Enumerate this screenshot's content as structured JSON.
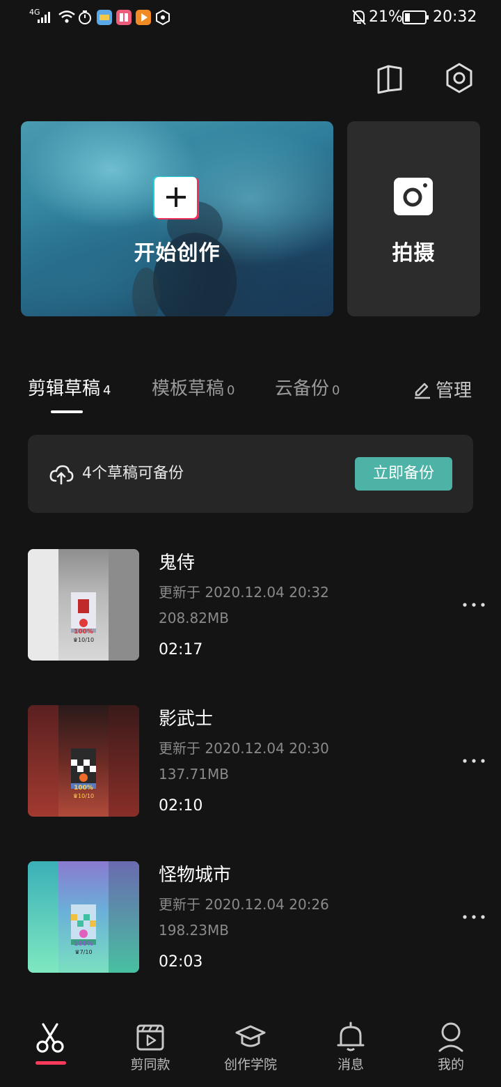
{
  "status_bar": {
    "network": "4G",
    "battery": "21%",
    "time": "20:32"
  },
  "header": {
    "icons": [
      "tutorial-book-icon",
      "settings-hexagon-icon"
    ]
  },
  "hero": {
    "create_label": "开始创作",
    "shoot_label": "拍摄"
  },
  "tabs": [
    {
      "label": "剪辑草稿",
      "count": "4"
    },
    {
      "label": "模板草稿",
      "count": "0"
    },
    {
      "label": "云备份",
      "count": "0"
    }
  ],
  "manage_label": "管理",
  "backup": {
    "text": "4个草稿可备份",
    "button": "立即备份"
  },
  "drafts": [
    {
      "title": "鬼侍",
      "updated": "更新于 2020.12.04 20:32",
      "size": "208.82MB",
      "duration": "02:17",
      "thumb_pct": "100%",
      "thumb_level": "♛10/10"
    },
    {
      "title": "影武士",
      "updated": "更新于 2020.12.04 20:30",
      "size": "137.71MB",
      "duration": "02:10",
      "thumb_pct": "100%",
      "thumb_level": "♛10/10"
    },
    {
      "title": "怪物城市",
      "updated": "更新于 2020.12.04 20:26",
      "size": "198.23MB",
      "duration": "02:03",
      "thumb_pct": "100%",
      "thumb_level": "♛7/10"
    }
  ],
  "bottom_nav": [
    {
      "label": "",
      "icon": "scissors-icon"
    },
    {
      "label": "剪同款",
      "icon": "clapper-video-icon"
    },
    {
      "label": "创作学院",
      "icon": "graduation-cap-icon"
    },
    {
      "label": "消息",
      "icon": "bell-icon"
    },
    {
      "label": "我的",
      "icon": "person-icon"
    }
  ],
  "colors": {
    "background": "#141414",
    "accent": "#4cb3a6",
    "nav_active": "#ff3b5c"
  }
}
